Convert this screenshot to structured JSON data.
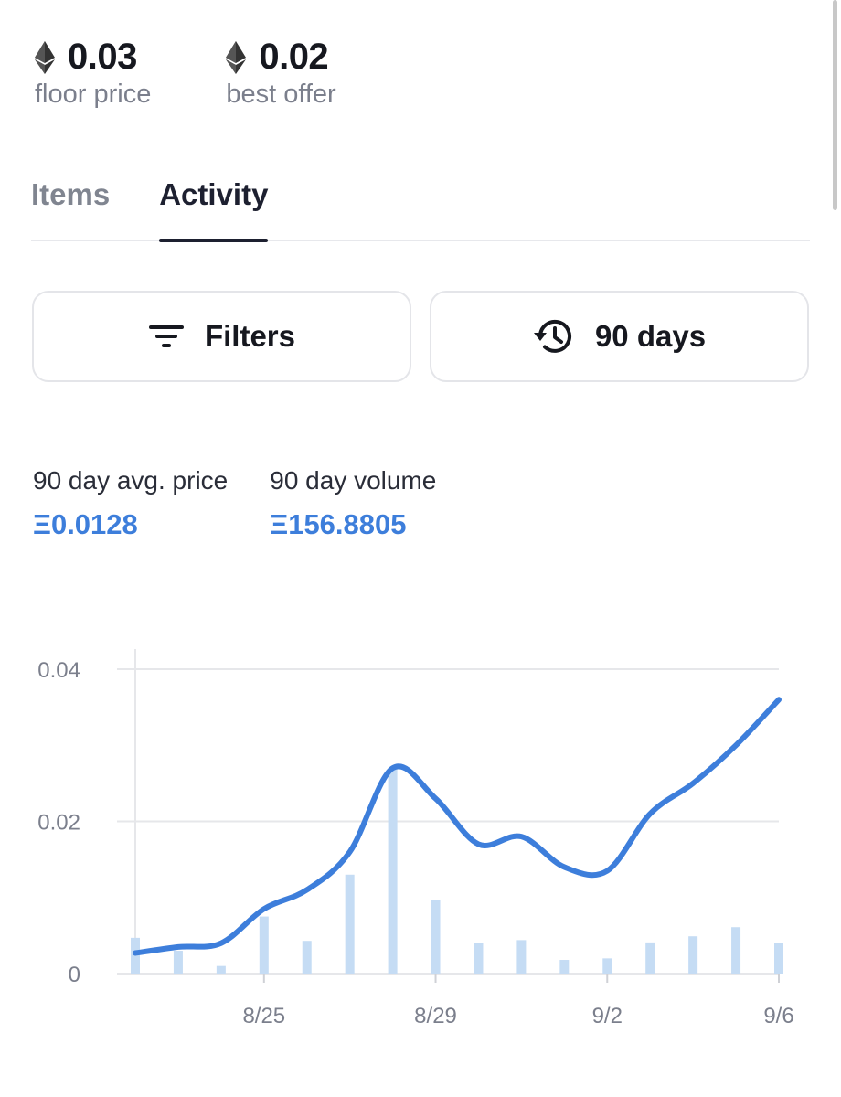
{
  "stats": {
    "floor": {
      "value": "0.03",
      "label": "floor price",
      "icon": "ethereum-icon"
    },
    "offer": {
      "value": "0.02",
      "label": "best offer",
      "icon": "ethereum-icon"
    }
  },
  "tabs": [
    {
      "label": "Items",
      "active": false
    },
    {
      "label": "Activity",
      "active": true
    }
  ],
  "buttons": {
    "filters": {
      "label": "Filters",
      "icon": "filter-icon"
    },
    "days": {
      "label": "90 days",
      "icon": "history-icon"
    }
  },
  "metrics": {
    "avg_price": {
      "label": "90 day avg. price",
      "value": "Ξ0.0128"
    },
    "volume": {
      "label": "90 day volume",
      "value": "Ξ156.8805"
    }
  },
  "colors": {
    "accent": "#3d7edb",
    "bar": "#c5dcf4",
    "grid": "#e6e7ea",
    "text_muted": "#7b7f8c"
  },
  "chart_data": {
    "type": "line",
    "x_tick_labels": [
      "8/25",
      "8/29",
      "9/2",
      "9/6"
    ],
    "y_tick_labels": [
      "0",
      "0.02",
      "0.04"
    ],
    "ylim": [
      0,
      0.04
    ],
    "grid": true,
    "series": [
      {
        "type": "line",
        "x": [
          22,
          23,
          24,
          25,
          26,
          27,
          28,
          29,
          30,
          31,
          32,
          33,
          34,
          35,
          36,
          37
        ],
        "values": [
          0.0027,
          0.0035,
          0.004,
          0.0085,
          0.011,
          0.016,
          0.027,
          0.023,
          0.017,
          0.018,
          0.014,
          0.0135,
          0.021,
          0.025,
          0.03,
          0.036
        ]
      },
      {
        "type": "bar",
        "x": [
          22,
          23,
          24,
          25,
          26,
          27,
          28,
          29,
          30,
          31,
          32,
          33,
          34,
          35,
          36,
          37
        ],
        "values": [
          0.0047,
          0.003,
          0.001,
          0.0075,
          0.0043,
          0.013,
          0.027,
          0.0097,
          0.004,
          0.0044,
          0.0018,
          0.002,
          0.0041,
          0.0049,
          0.0061,
          0.004
        ]
      }
    ]
  }
}
